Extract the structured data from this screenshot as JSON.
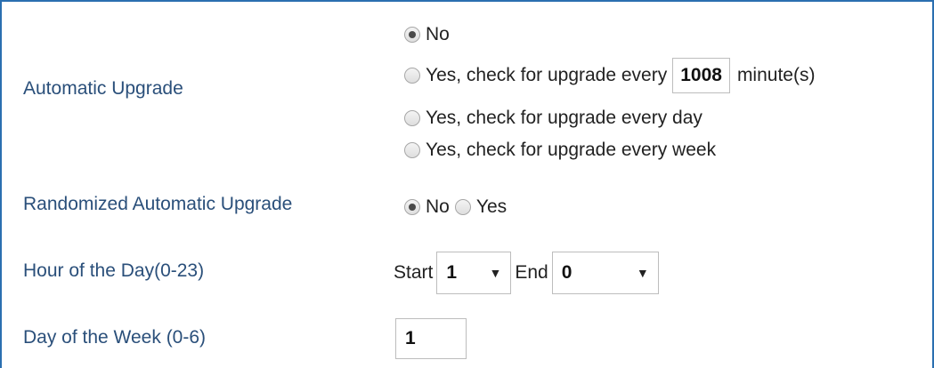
{
  "automatic_upgrade": {
    "label": "Automatic Upgrade",
    "options": [
      {
        "label": "No",
        "checked": true
      },
      {
        "label_before": "Yes, check for upgrade every",
        "value": "1008",
        "label_after": "minute(s)",
        "checked": false
      },
      {
        "label": "Yes, check for upgrade every day",
        "checked": false
      },
      {
        "label": "Yes, check for upgrade every week",
        "checked": false
      }
    ]
  },
  "randomized_upgrade": {
    "label": "Randomized Automatic Upgrade",
    "no_label": "No",
    "yes_label": "Yes",
    "selected": "No"
  },
  "hour_of_day": {
    "label": "Hour of the Day(0-23)",
    "start_label": "Start",
    "start_value": "1",
    "end_label": "End",
    "end_value": "0"
  },
  "day_of_week": {
    "label": "Day of the Week (0-6)",
    "value": "1"
  },
  "colors": {
    "label_color": "#2a4f7a",
    "border_color": "#2a6fb0"
  }
}
